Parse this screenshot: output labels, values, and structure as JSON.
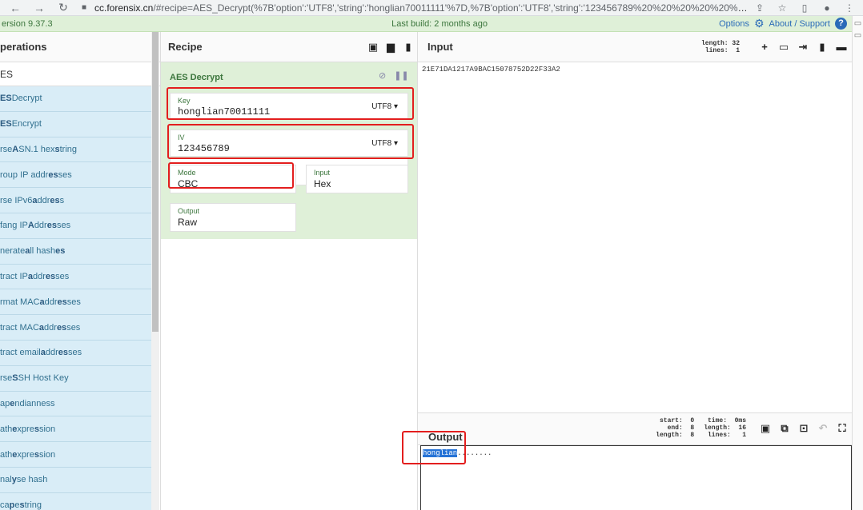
{
  "browser": {
    "url_host": "cc.forensix.cn",
    "url_rest": "/#recipe=AES_Decrypt(%7B'option':'UTF8','string':'honglian70011111'%7D,%7B'option':'UTF8','string':'123456789%20%20%20%20%20%20%20%..."
  },
  "banner": {
    "version": "ersion 9.37.3",
    "last_build": "Last build: 2 months ago",
    "options": "Options",
    "about": "About / Support"
  },
  "operations": {
    "title": "perations",
    "search_value": "ES",
    "items": [
      {
        "pre": "",
        "bold": "ES",
        "post": " Decrypt"
      },
      {
        "pre": "",
        "bold": "ES",
        "post": " Encrypt"
      },
      {
        "pre": "rse ",
        "bold": "A",
        "post": "SN.1 hex ",
        "bold2": "s",
        "post2": "tring"
      },
      {
        "pre": "roup IP addr",
        "bold": "es",
        "post": "ses"
      },
      {
        "pre": "rse IPv6 ",
        "bold": "a",
        "post": "ddr",
        "bold2": "es",
        "post2": "s"
      },
      {
        "pre": "fang IP ",
        "bold": "A",
        "post": "ddr",
        "bold2": "es",
        "post2": "ses"
      },
      {
        "pre": "nerate ",
        "bold": "a",
        "post": "ll hash",
        "bold2": "es",
        "post2": ""
      },
      {
        "pre": "tract IP ",
        "bold": "a",
        "post": "ddr",
        "bold2": "es",
        "post2": "ses"
      },
      {
        "pre": "rmat MAC ",
        "bold": "a",
        "post": "ddr",
        "bold2": "es",
        "post2": "ses"
      },
      {
        "pre": "tract MAC ",
        "bold": "a",
        "post": "ddr",
        "bold2": "es",
        "post2": "ses"
      },
      {
        "pre": "tract email ",
        "bold": "a",
        "post": "ddr",
        "bold2": "es",
        "post2": "ses"
      },
      {
        "pre": "rse ",
        "bold": "S",
        "post": "SH Host Key"
      },
      {
        "pre": "ap ",
        "bold": "e",
        "post": "ndianness"
      },
      {
        "pre": "ath ",
        "bold": "e",
        "post": "xpre",
        "bold2": "s",
        "post2": "sion"
      },
      {
        "pre": "ath ",
        "bold": "e",
        "post": "xpre",
        "bold2": "s",
        "post2": "sion"
      },
      {
        "pre": "nal",
        "bold": "y",
        "post": "se hash"
      },
      {
        "pre": "ca",
        "bold": "p",
        "post": "e ",
        "bold2": "s",
        "post2": "tring"
      }
    ]
  },
  "recipe": {
    "title": "Recipe",
    "operation": {
      "name": "AES Decrypt",
      "key": {
        "label": "Key",
        "value": "honglian70011111",
        "encoding": "UTF8 ▾"
      },
      "iv": {
        "label": "IV",
        "value": "123456789",
        "encoding": "UTF8 ▾"
      },
      "mode": {
        "label": "Mode",
        "value": "CBC"
      },
      "input": {
        "label": "Input",
        "value": "Hex"
      },
      "output": {
        "label": "Output",
        "value": "Raw"
      }
    }
  },
  "input": {
    "title": "Input",
    "stats": "length: 32\n lines:  1",
    "text": "21E71DA1217A9BAC15078752D22F33A2"
  },
  "output": {
    "title": "Output",
    "stats_left": "start:  0\n  end:  8\nlength:  8",
    "stats_right": "time:  0ms\nlength:  16\n lines:   1",
    "text_highlight": "honglian",
    "text_rest": "........"
  },
  "colors": {
    "accent": "#2a6bb8",
    "op_bg": "#d9edf7",
    "recipe_bg": "#dff0d8",
    "annotation": "#e31e1e"
  }
}
